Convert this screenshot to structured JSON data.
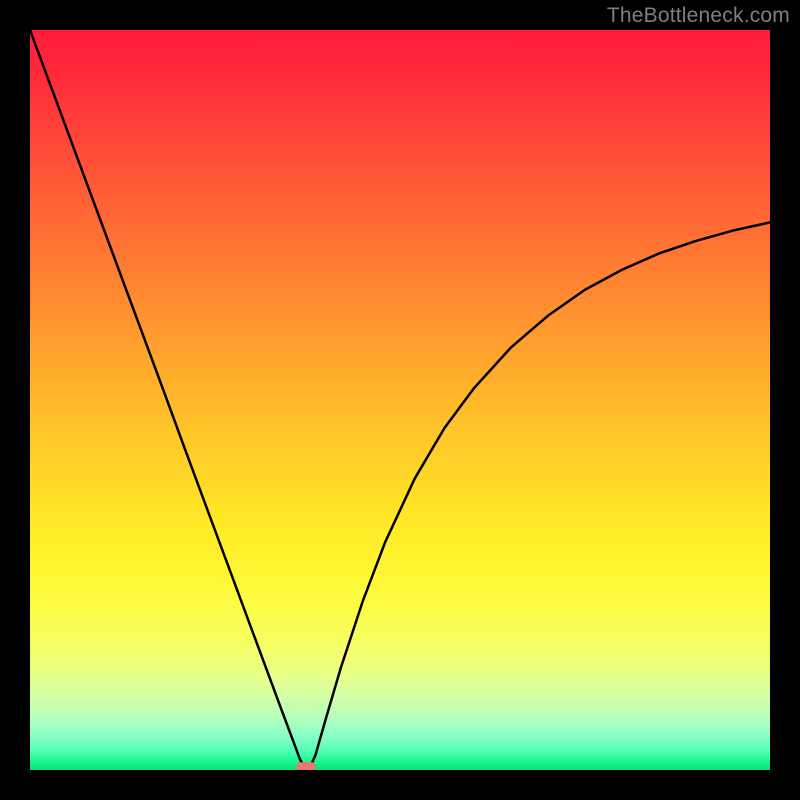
{
  "watermark": "TheBottleneck.com",
  "chart_data": {
    "type": "line",
    "title": "",
    "xlabel": "",
    "ylabel": "",
    "xlim": [
      0,
      100
    ],
    "ylim": [
      0,
      100
    ],
    "grid": false,
    "legend": false,
    "background": "vertical-gradient-red-to-green",
    "series": [
      {
        "name": "bottleneck-curve",
        "x": [
          0,
          3,
          6,
          9,
          12,
          15,
          18,
          21,
          24,
          27,
          30,
          32,
          34,
          35.5,
          36.5,
          37.3,
          38,
          38.6,
          40,
          42,
          45,
          48,
          52,
          56,
          60,
          65,
          70,
          75,
          80,
          85,
          90,
          95,
          100
        ],
        "y": [
          100,
          91.9,
          83.8,
          75.7,
          67.6,
          59.5,
          51.4,
          43.2,
          35.1,
          27.0,
          18.9,
          13.5,
          8.1,
          4.1,
          1.4,
          0.0,
          0.7,
          2.1,
          7.0,
          13.8,
          22.9,
          30.8,
          39.4,
          46.2,
          51.6,
          57.1,
          61.4,
          64.9,
          67.6,
          69.8,
          71.5,
          72.9,
          74.0
        ],
        "stroke": "#000000",
        "stroke_width": 2.5
      }
    ],
    "marker": {
      "name": "optimal-point",
      "x": 37.3,
      "y": 0.4,
      "color": "#e9796d",
      "shape": "rounded",
      "width_pct": 2.6,
      "height_pct": 1.3
    }
  }
}
